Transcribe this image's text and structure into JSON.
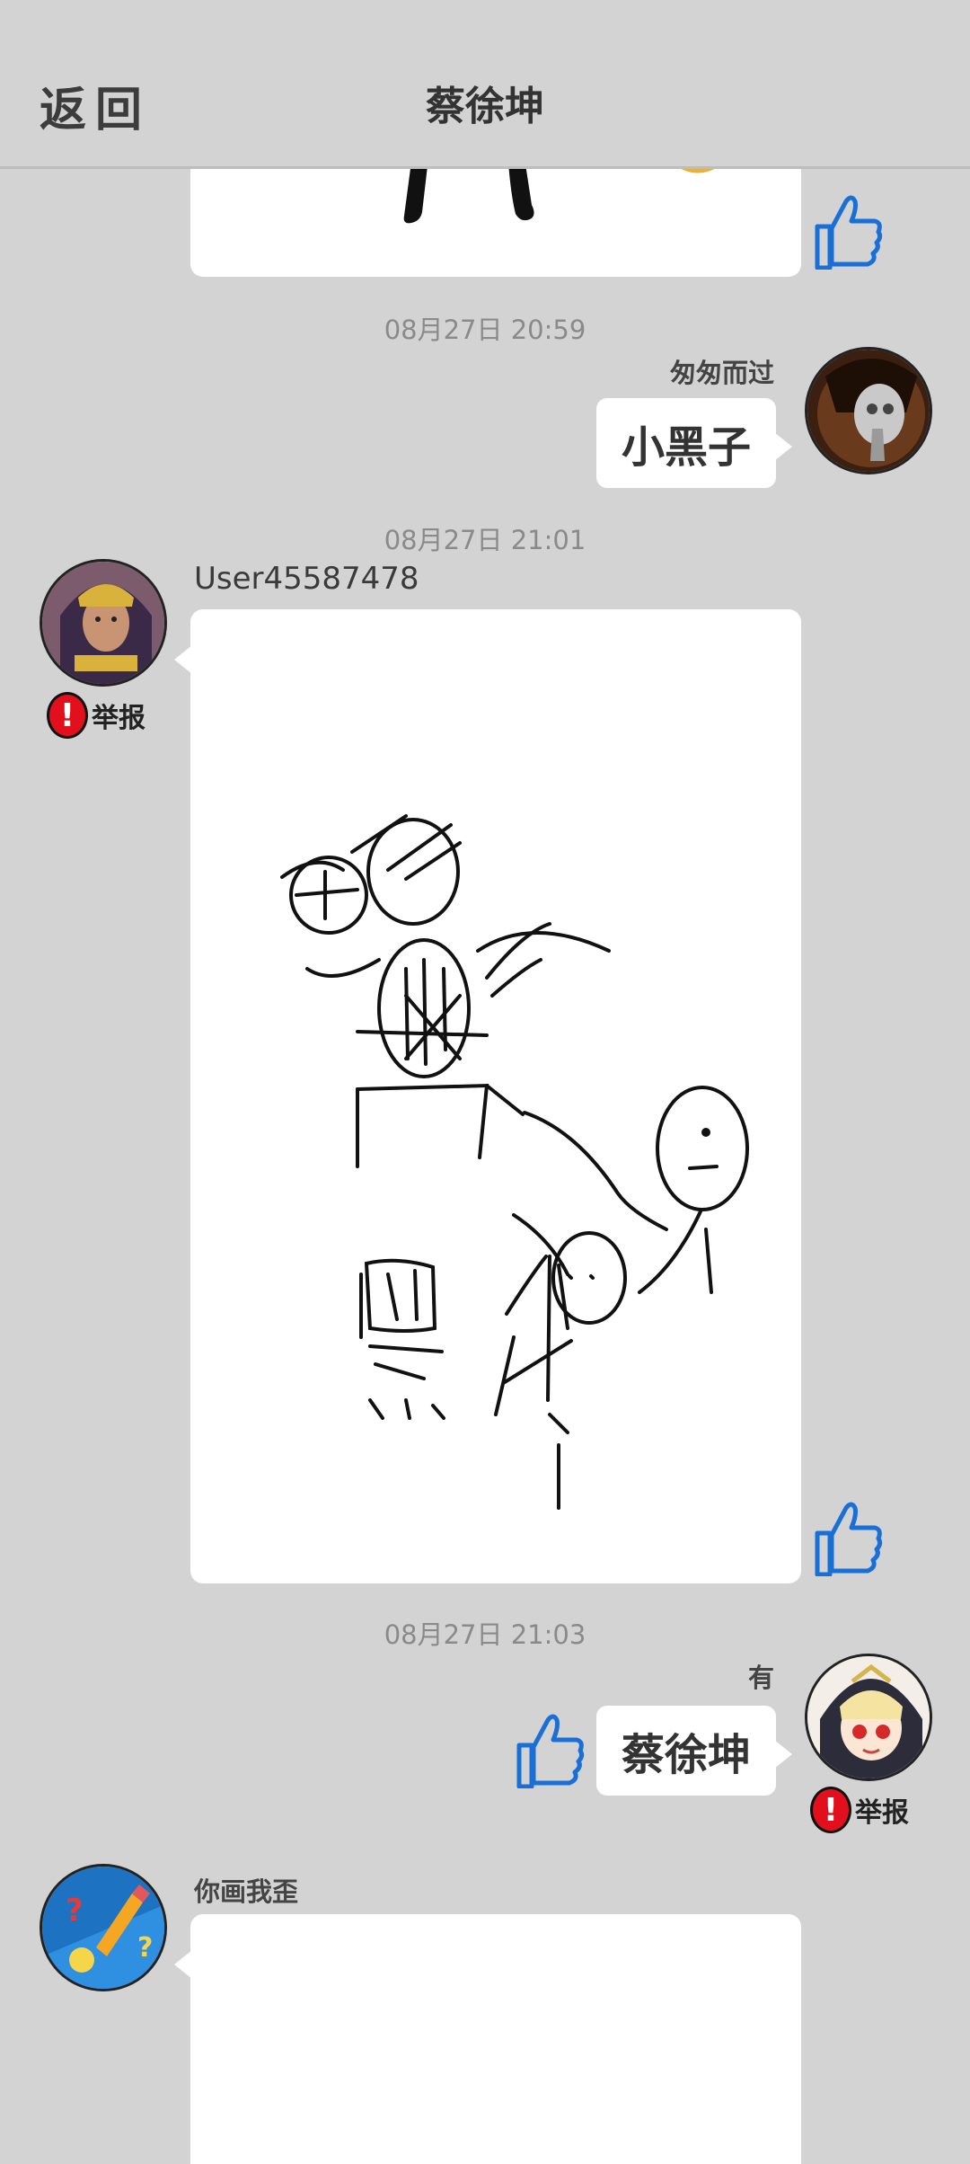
{
  "header": {
    "back_label": "返回",
    "title": "蔡徐坤"
  },
  "messages": [
    {
      "time": "08月27日  20:59",
      "sender": "匆匆而过",
      "text": "小黑子"
    },
    {
      "time": "08月27日  21:01",
      "sender": "User45587478",
      "report": "举报"
    },
    {
      "time": "08月27日  21:03",
      "sender": "有",
      "text": "蔡徐坤",
      "report": "举报"
    },
    {
      "sender": "你画我歪"
    }
  ],
  "icons": {
    "like": "thumbs-up-icon",
    "report": "exclamation-icon"
  },
  "colors": {
    "background": "#d3d3d3",
    "like_blue": "#1a6fd6",
    "report_red": "#e2101d"
  }
}
